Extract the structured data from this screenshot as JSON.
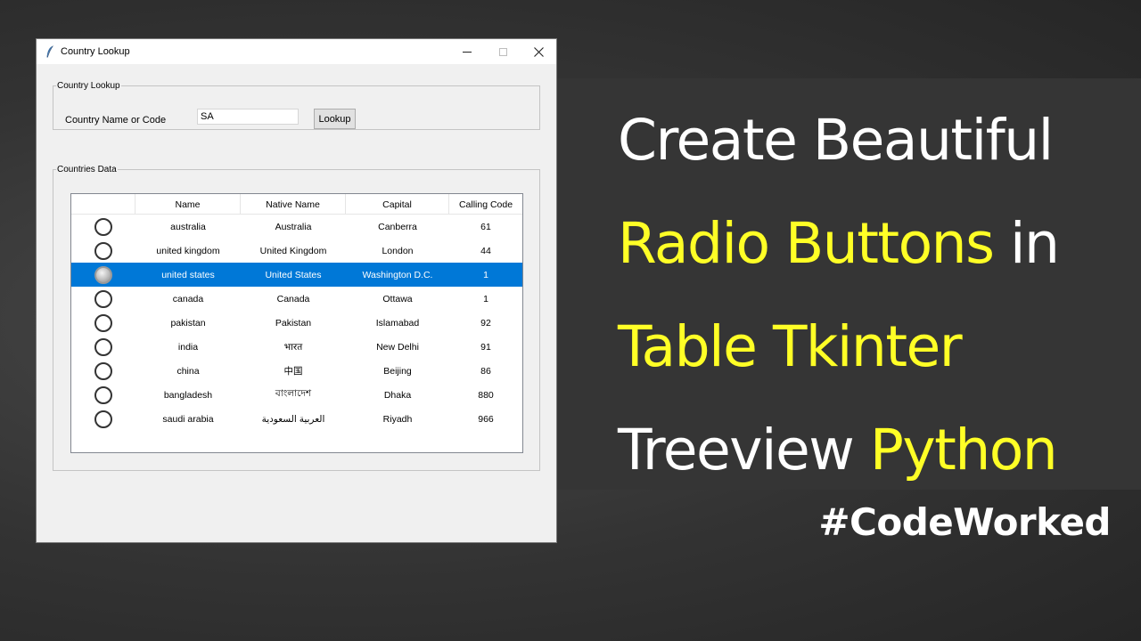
{
  "window": {
    "title": "Country Lookup"
  },
  "lookup": {
    "group_label": "Country Lookup",
    "field_label": "Country Name or Code",
    "field_value": "SA",
    "button_label": "Lookup"
  },
  "data": {
    "group_label": "Countries Data",
    "columns": [
      "Name",
      "Native Name",
      "Capital",
      "Calling Code"
    ],
    "selected_row": 2,
    "rows": [
      {
        "name": "australia",
        "native": "Australia",
        "capital": "Canberra",
        "code": "61"
      },
      {
        "name": "united kingdom",
        "native": "United Kingdom",
        "capital": "London",
        "code": "44"
      },
      {
        "name": "united states",
        "native": "United States",
        "capital": "Washington D.C.",
        "code": "1"
      },
      {
        "name": "canada",
        "native": "Canada",
        "capital": "Ottawa",
        "code": "1"
      },
      {
        "name": "pakistan",
        "native": "Pakistan",
        "capital": "Islamabad",
        "code": "92"
      },
      {
        "name": "india",
        "native": "भारत",
        "capital": "New Delhi",
        "code": "91"
      },
      {
        "name": "china",
        "native": "中国",
        "capital": "Beijing",
        "code": "86"
      },
      {
        "name": "bangladesh",
        "native": "বাংলাদেশ",
        "capital": "Dhaka",
        "code": "880"
      },
      {
        "name": "saudi arabia",
        "native": "العربية السعودية",
        "capital": "Riyadh",
        "code": "966"
      }
    ]
  },
  "headline": {
    "line1": "Create Beautiful",
    "line2_yellow": "Radio Buttons",
    "line2_white": " in",
    "line3_yellow": "Table Tkinter",
    "line4_white": "Treeview ",
    "line4_yellow": "Python",
    "hashtag": "#CodeWorked"
  },
  "colors": {
    "accent_yellow": "#ffff26",
    "selection_blue": "#0078d7"
  }
}
